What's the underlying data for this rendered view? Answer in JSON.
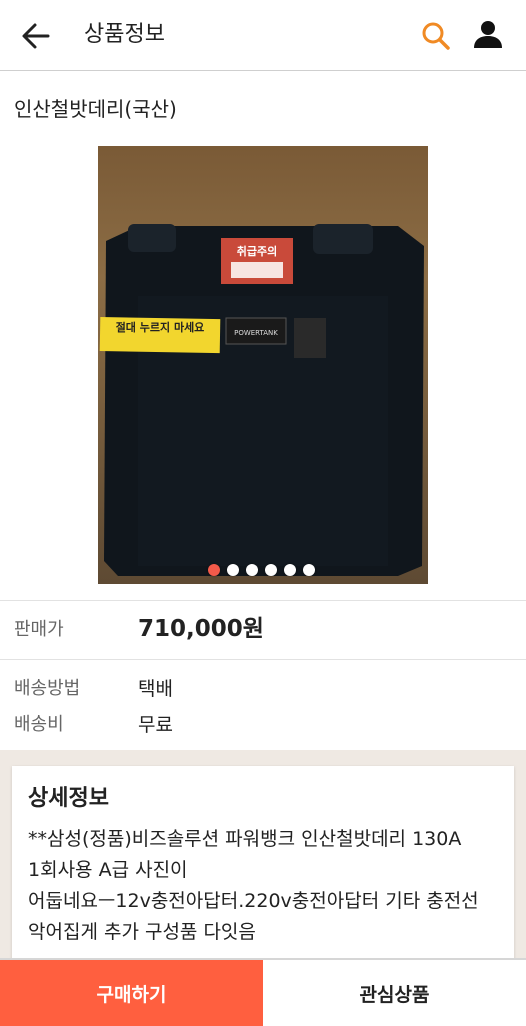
{
  "header": {
    "title": "상품정보",
    "back_icon": "arrow-left-icon",
    "search_icon": "search-icon",
    "user_icon": "user-icon",
    "search_color": "#f08a24"
  },
  "product": {
    "name": "인산철밧데리(국산)",
    "photo": {
      "sticker_top_title": "취급주의",
      "sticker_warning": "절대 누르지 마세요",
      "sticker_brand": "POWERTANK"
    },
    "gallery": {
      "current": 1,
      "total": 6,
      "active_dot_color": "#f35a4a"
    }
  },
  "info": {
    "price_label": "판매가",
    "price_value": "710,000원",
    "shipping_method_label": "배송방법",
    "shipping_method_value": "택배",
    "shipping_fee_label": "배송비",
    "shipping_fee_value": "무료"
  },
  "detail": {
    "title": "상세정보",
    "body": "**삼성(정품)비즈솔루션 파워뱅크 인산철밧데리 130A 1회사용 A급 사진이 어둡네요ㅡ12v충전아답터.220v충전아답터 기타 충전선 악어집게 추가 구성품 다잇음"
  },
  "actions": {
    "buy_label": "구매하기",
    "wishlist_label": "관심상품",
    "buy_color": "#ff5f3f"
  }
}
